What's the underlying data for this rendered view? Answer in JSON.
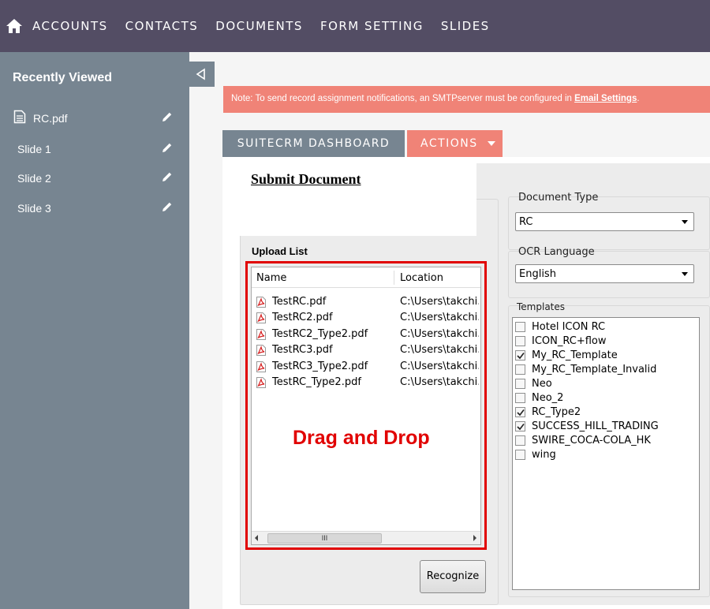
{
  "nav": {
    "items": [
      "ACCOUNTS",
      "CONTACTS",
      "DOCUMENTS",
      "FORM SETTING",
      "SLIDES"
    ]
  },
  "sidebar": {
    "title": "Recently Viewed",
    "items": [
      {
        "label": "RC.pdf",
        "icon": "document-icon"
      },
      {
        "label": "Slide 1"
      },
      {
        "label": "Slide 2"
      },
      {
        "label": "Slide 3"
      }
    ]
  },
  "note": {
    "text": "Note: To send record assignment notifications, an SMTPserver must be configured in ",
    "link": "Email Settings",
    "suffix": "."
  },
  "tabs": {
    "dashboard": "SUITECRM DASHBOARD",
    "actions": "ACTIONS"
  },
  "form": {
    "title": "Submit Document",
    "document_type_label": "Document Type",
    "document_type_value": "RC",
    "ocr_language_label": "OCR Language",
    "ocr_language_value": "English",
    "templates_label": "Templates",
    "templates": [
      {
        "label": "Hotel ICON RC",
        "checked": false
      },
      {
        "label": "ICON_RC+flow",
        "checked": false
      },
      {
        "label": "My_RC_Template",
        "checked": true
      },
      {
        "label": "My_RC_Template_Invalid",
        "checked": false
      },
      {
        "label": "Neo",
        "checked": false
      },
      {
        "label": "Neo_2",
        "checked": false
      },
      {
        "label": "RC_Type2",
        "checked": true
      },
      {
        "label": "SUCCESS_HILL_TRADING",
        "checked": true
      },
      {
        "label": "SWIRE_COCA-COLA_HK",
        "checked": false
      },
      {
        "label": "wing",
        "checked": false
      }
    ],
    "upload_list_label": "Upload List",
    "columns": {
      "name": "Name",
      "location": "Location"
    },
    "files": [
      {
        "name": "TestRC.pdf",
        "location": "C:\\Users\\takchi.lin\\D"
      },
      {
        "name": "TestRC2.pdf",
        "location": "C:\\Users\\takchi.lin\\D"
      },
      {
        "name": "TestRC2_Type2.pdf",
        "location": "C:\\Users\\takchi.lin\\D"
      },
      {
        "name": "TestRC3.pdf",
        "location": "C:\\Users\\takchi.lin\\D"
      },
      {
        "name": "TestRC3_Type2.pdf",
        "location": "C:\\Users\\takchi.lin\\D"
      },
      {
        "name": "TestRC_Type2.pdf",
        "location": "C:\\Users\\takchi.lin\\D"
      }
    ],
    "scroll_thumb": "III",
    "drag_drop_text": "Drag and Drop",
    "recognize_label": "Recognize"
  },
  "colors": {
    "nav_bg": "#534d64",
    "sidebar_bg": "#778591",
    "accent": "#f08377",
    "highlight_red": "#e10000"
  }
}
